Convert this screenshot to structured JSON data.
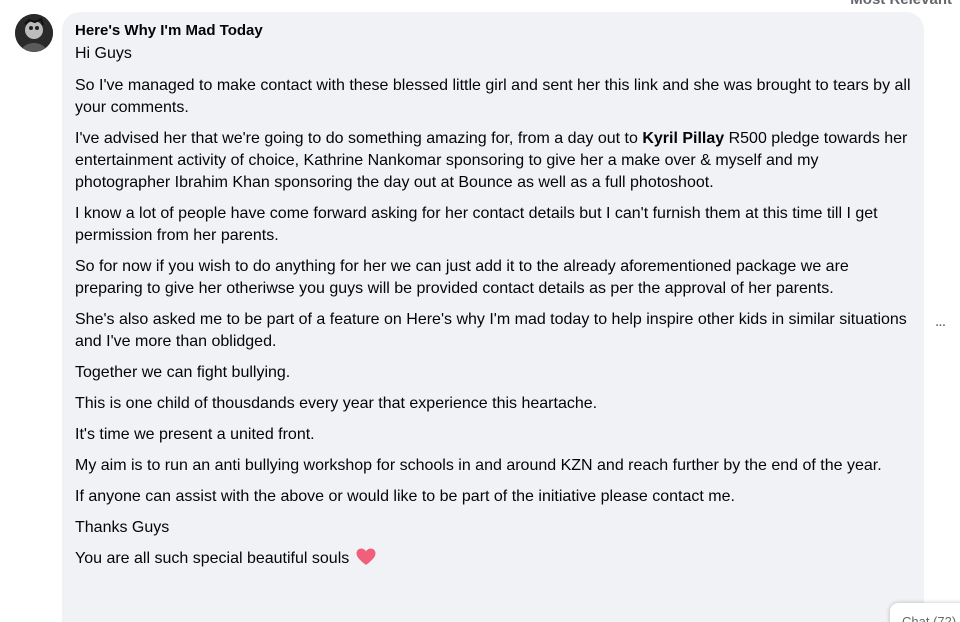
{
  "sort_filter": {
    "label": "Most Relevant"
  },
  "comment": {
    "author": "Here's Why I'm Mad Today",
    "greeting": "Hi Guys",
    "p1": "So I've managed to make contact with these blessed little girl and sent her this link and she was brought to tears by all your comments.",
    "p2_before": "I've advised her that we're going to do something amazing for, from a day out to ",
    "p2_mention": "Kyril Pillay",
    "p2_after": " R500 pledge towards her entertainment activity of choice, Kathrine Nankomar sponsoring to give her a make over & myself and my photographer Ibrahim Khan sponsoring the day out at Bounce as well as a full photoshoot.",
    "p3": "I know a lot of people have come forward asking for her contact details but I can't furnish them at this time till I get permission from her parents.",
    "p4": "So for now if you wish to do anything for her we can just add it to the already aforementioned package we are preparing to give her otheriwse you guys will be provided contact details as per the approval of her parents.",
    "p5": "She's also asked me to be part of a feature on Here's why I'm mad today to help inspire other kids in similar situations and I've more than oblidged.",
    "p6": "Together we can fight bullying.",
    "p7": "This is one child of thousdands every year that experience this heartache.",
    "p8": "It's time we present a united front.",
    "p9": "My aim is to run an anti bullying workshop for schools in and around KZN and reach further by the end of the year.",
    "p10": "If anyone can assist with the above or would like to be part of the initiative please contact me.",
    "p11": "Thanks Guys",
    "p12": "You are all such special beautiful souls",
    "p12_emoji": "heart-icon",
    "emoji_color": "#f0607a"
  },
  "more_options": {
    "label": "..."
  },
  "chat": {
    "label": "Chat (72)"
  }
}
